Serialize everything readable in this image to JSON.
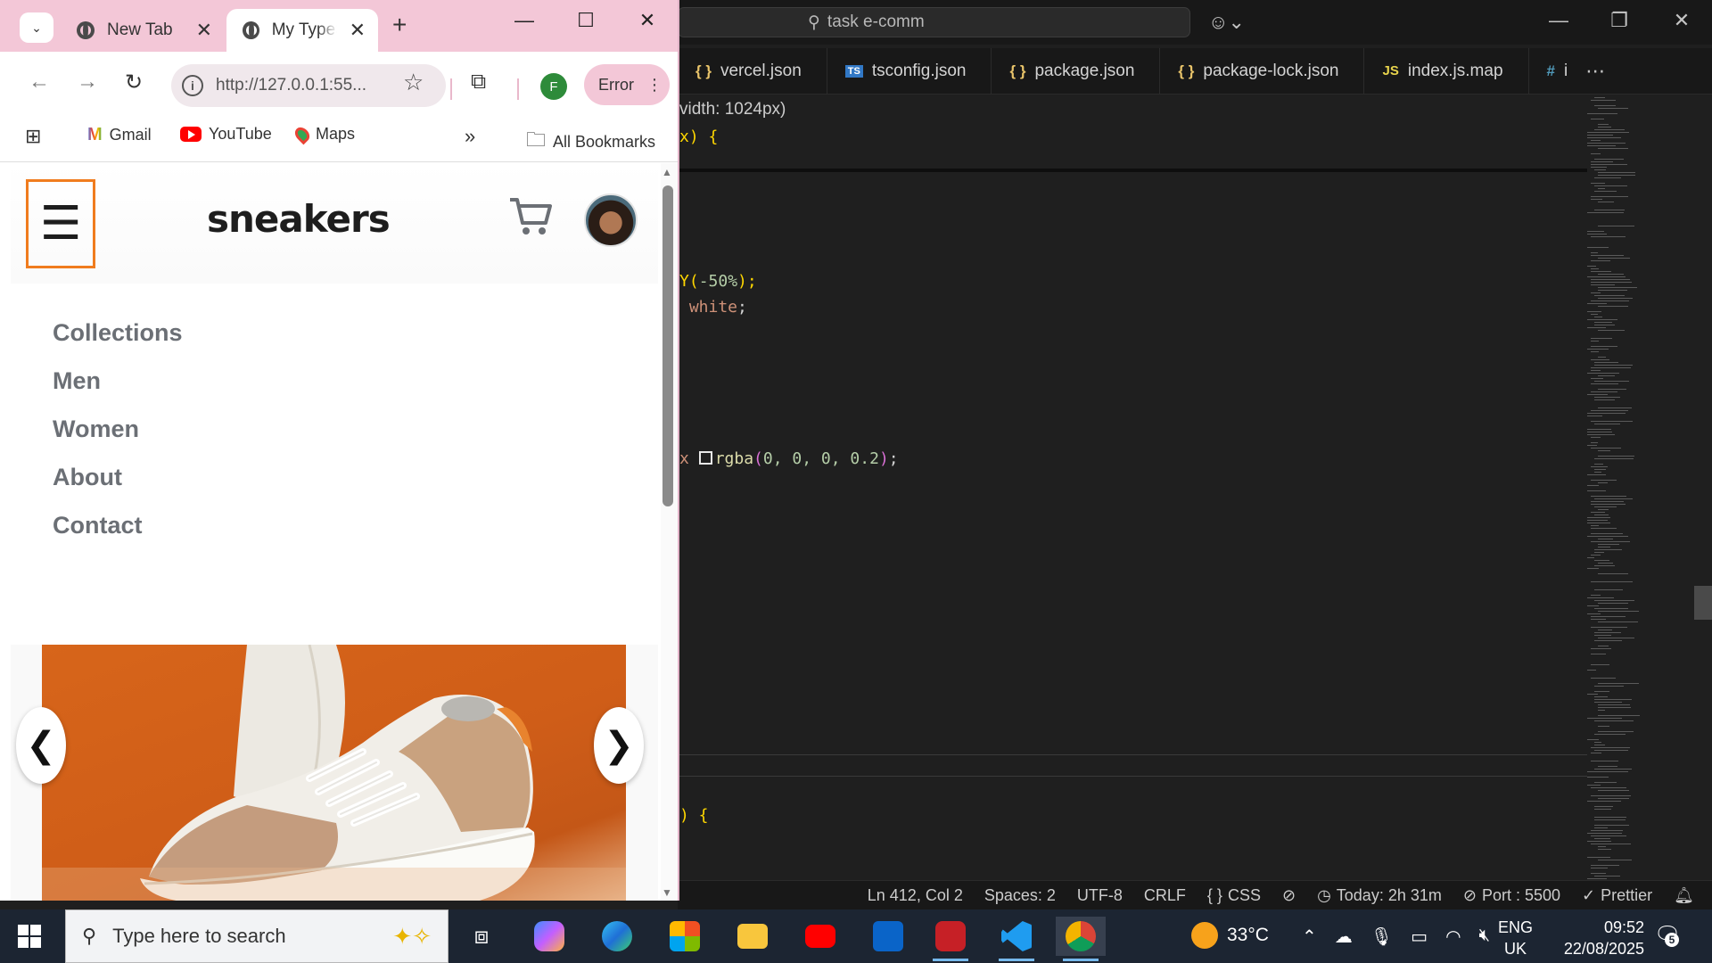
{
  "vscode": {
    "command_center": "task e-comm",
    "tabs": [
      {
        "icon": "{ }",
        "label": "vercel.json"
      },
      {
        "icon": "TS",
        "label": "tsconfig.json"
      },
      {
        "icon": "{ }",
        "label": "package.json"
      },
      {
        "icon": "{ }",
        "label": "package-lock.json"
      },
      {
        "icon": "JS",
        "label": "index.js.map"
      },
      {
        "icon": "#",
        "label": "i"
      }
    ],
    "code": {
      "line1": "vidth: 1024px)",
      "line2": "x) {",
      "line3a": "Y(",
      "line3b": "-50%",
      "line3c": ");",
      "line4a": " white",
      "line4b": ";",
      "line5a": "x ",
      "line5b": "rgba",
      "line5c": "(",
      "line5d": "0, 0, 0, 0.2",
      "line5e": ");",
      "line6": ") {"
    },
    "status": {
      "position": "Ln 412, Col 2",
      "spaces": "Spaces: 2",
      "encoding": "UTF-8",
      "eol": "CRLF",
      "language": "CSS",
      "time": "Today: 2h 31m",
      "port": "Port : 5500",
      "formatter": "Prettier"
    }
  },
  "chrome": {
    "tabs": [
      {
        "label": "New Tab"
      },
      {
        "label": "My TypeS"
      }
    ],
    "url": "http://127.0.0.1:55...",
    "profile_initial": "F",
    "error_label": "Error",
    "bookmarks": {
      "gmail": "Gmail",
      "youtube": "YouTube",
      "maps": "Maps",
      "overflow": "»",
      "all": "All Bookmarks"
    }
  },
  "site": {
    "logo": "sneakers",
    "nav": [
      "Collections",
      "Men",
      "Women",
      "About",
      "Contact"
    ],
    "prev": "❮",
    "next": "❯"
  },
  "taskbar": {
    "search_placeholder": "Type here to search",
    "temperature": "33°C",
    "lang_top": "ENG",
    "lang_bottom": "UK",
    "time": "09:52",
    "date": "22/08/2025",
    "notifications": "5"
  },
  "colors": {
    "chrome_tab_strip": "#f3c7d7",
    "menu_border": "#f07c1e",
    "hero_orange": "#d7651a",
    "vscode_bg": "#1f1f1f",
    "taskbar_bg": "#1c2532"
  }
}
